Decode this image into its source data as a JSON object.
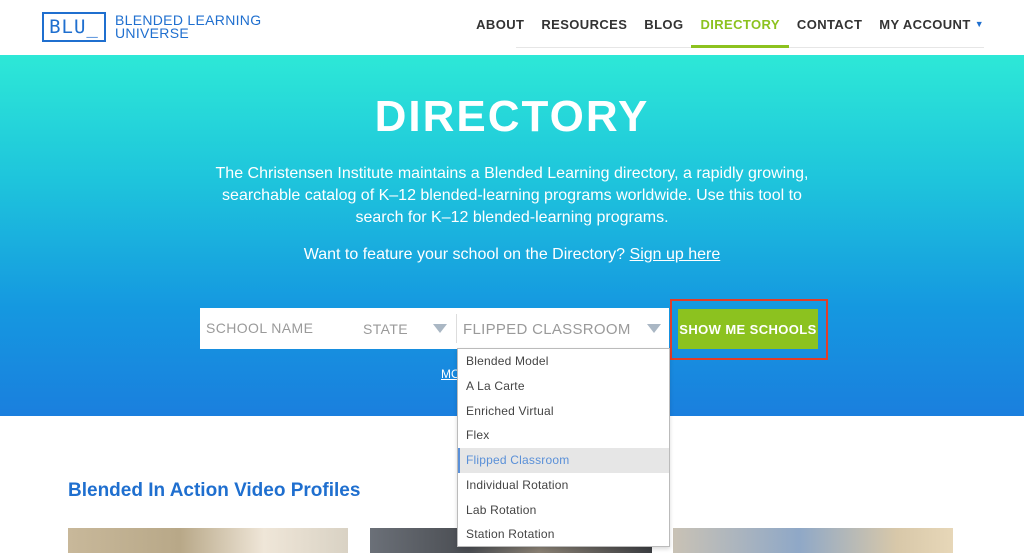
{
  "logo": {
    "mark": "BLU_",
    "line1": "BLENDED LEARNING",
    "line2": "UNIVERSE"
  },
  "nav": {
    "items": [
      {
        "label": "ABOUT"
      },
      {
        "label": "RESOURCES"
      },
      {
        "label": "BLOG"
      },
      {
        "label": "DIRECTORY",
        "active": true
      },
      {
        "label": "CONTACT"
      },
      {
        "label": "MY ACCOUNT"
      }
    ]
  },
  "hero": {
    "title": "DIRECTORY",
    "description": "The Christensen Institute maintains a Blended Learning directory, a rapidly growing, searchable catalog of K–12 blended-learning programs worldwide. Use this tool to search for K–12 blended-learning programs.",
    "cta_text": "Want to feature your school on the Directory?",
    "cta_link": "Sign up here"
  },
  "search": {
    "school_placeholder": "SCHOOL NAME",
    "state_value": "STATE",
    "model_value": "FLIPPED CLASSROOM",
    "button_label": "SHOW ME SCHOOLS",
    "more_link": "MO"
  },
  "dropdown": {
    "options": [
      "Blended Model",
      "A La Carte",
      "Enriched Virtual",
      "Flex",
      "Flipped Classroom",
      "Individual Rotation",
      "Lab Rotation",
      "Station Rotation"
    ],
    "selected": "Flipped Classroom"
  },
  "content": {
    "section_title": "Blended In Action Video Profiles"
  },
  "colors": {
    "brand_blue": "#1f6fcf",
    "accent_green": "#8cc21f",
    "highlight_red": "#e23d28"
  }
}
